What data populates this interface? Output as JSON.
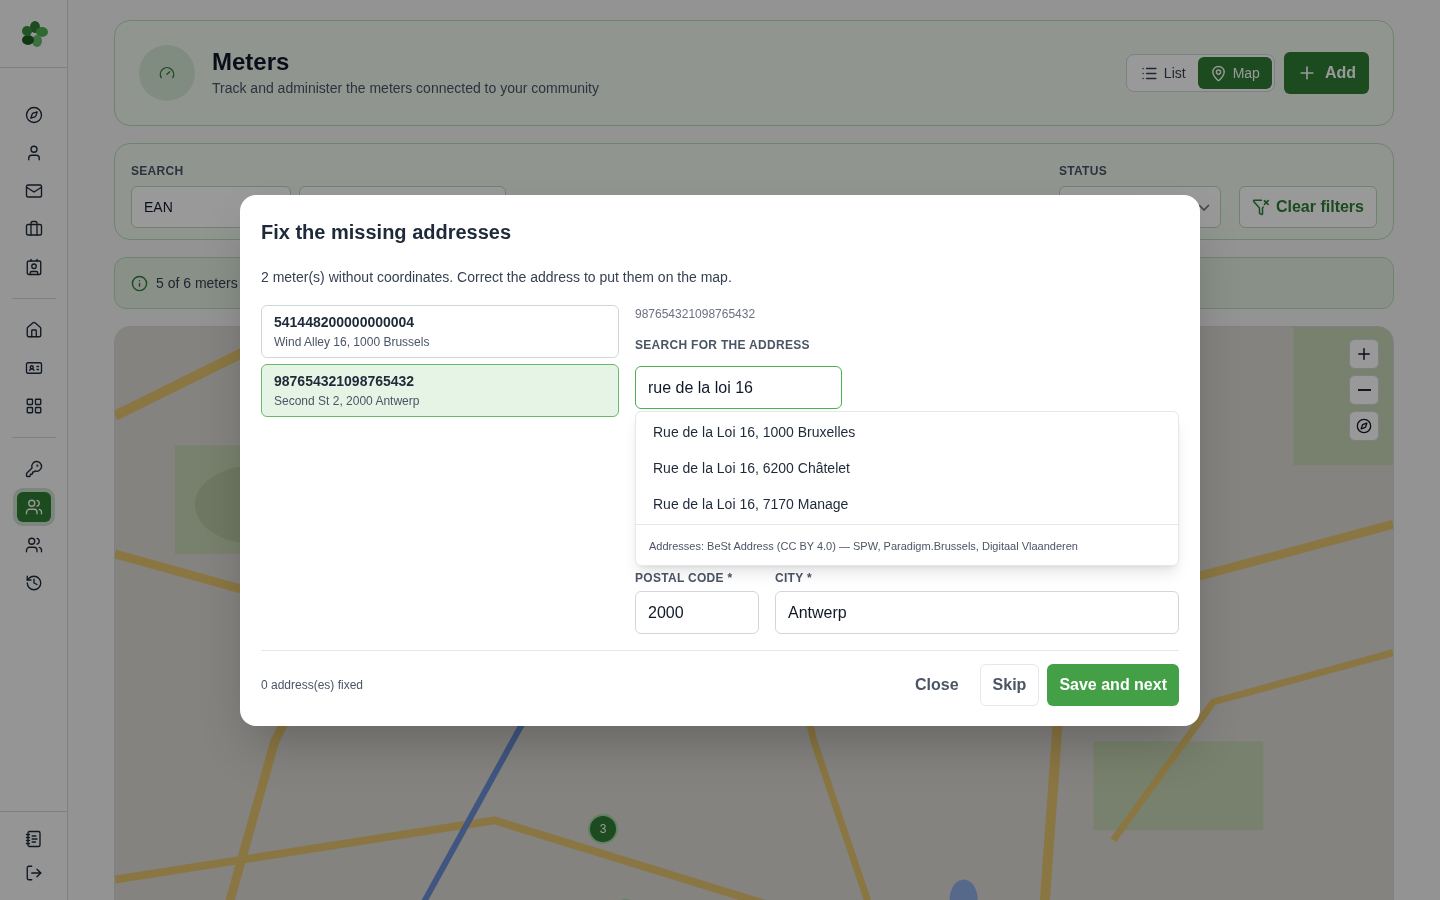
{
  "sidebar": {
    "groups": [
      {
        "items": [
          {
            "selected": false
          },
          {
            "selected": false
          },
          {
            "selected": false
          },
          {
            "selected": false
          },
          {
            "selected": false
          }
        ]
      },
      {
        "items": [
          {
            "selected": false
          },
          {
            "selected": false
          },
          {
            "selected": false
          }
        ]
      },
      {
        "items": [
          {
            "selected": false
          },
          {
            "selected": true
          },
          {
            "selected": false
          },
          {
            "selected": false
          }
        ]
      }
    ],
    "footer": [
      {
        "selected": false
      },
      {
        "selected": false
      }
    ]
  },
  "header": {
    "title": "Meters",
    "subtitle": "Track and administer the meters connected to your community",
    "views": [
      {
        "label": "List",
        "selected": false
      },
      {
        "label": "Map",
        "selected": true
      }
    ],
    "add_button": "Add"
  },
  "filters": {
    "search_label": "SEARCH",
    "search_type": "EAN",
    "status_label": "STATUS",
    "clear_button": "Clear filters"
  },
  "info": {
    "text": "5 of 6 meters"
  },
  "map": {
    "clusters": [
      {
        "count": "3"
      }
    ]
  },
  "modal": {
    "title": "Fix the missing addresses",
    "description": "2 meter(s) without coordinates. Correct the address to put them on the map.",
    "meters": [
      {
        "ean": "541448200000000004",
        "address": "Wind Alley 16, 1000 Brussels",
        "selected": false
      },
      {
        "ean": "987654321098765432",
        "address": "Second St 2, 2000 Antwerp",
        "selected": true
      }
    ],
    "detail": {
      "ean": "987654321098765432",
      "search_label": "SEARCH FOR THE ADDRESS",
      "search_value": "rue de la loi 16",
      "suggestions": [
        "Rue de la Loi 16, 1000 Bruxelles",
        "Rue de la Loi 16, 6200 Châtelet",
        "Rue de la Loi 16, 7170 Manage"
      ],
      "attribution": "Addresses: BeSt Address (CC BY 4.0) — SPW, Paradigm.Brussels, Digitaal Vlaanderen",
      "postal_code_label": "POSTAL CODE *",
      "postal_code": "2000",
      "city_label": "CITY *",
      "city": "Antwerp"
    },
    "fixed_count": "0 address(es) fixed",
    "close_button": "Close",
    "skip_button": "Skip",
    "save_button": "Save and next"
  }
}
